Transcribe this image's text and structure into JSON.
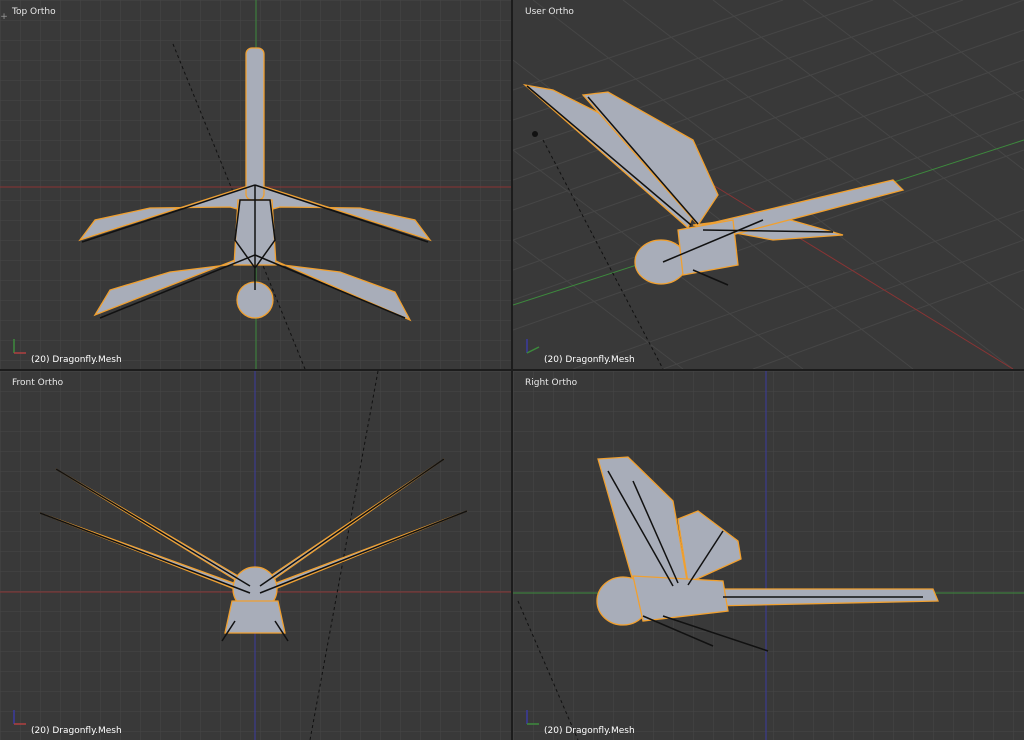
{
  "colors": {
    "viewport_bg": "#393939",
    "grid": "#464646",
    "x_axis": "#8a3434",
    "y_axis": "#3d8a3d",
    "z_axis": "#3a3aa0",
    "mesh_fill": "#a8adb9",
    "mesh_edge": "#f0a030",
    "bone": "#111111"
  },
  "viewports": [
    {
      "title": "Top Ortho",
      "status": "(20) Dragonfly.Mesh",
      "axes_labels": [
        "y",
        "x"
      ]
    },
    {
      "title": "User Ortho",
      "status": "(20) Dragonfly.Mesh",
      "axes_labels": [
        "z",
        "y"
      ]
    },
    {
      "title": "Front Ortho",
      "status": "(20) Dragonfly.Mesh",
      "axes_labels": [
        "z",
        "x"
      ]
    },
    {
      "title": "Right Ortho",
      "status": "(20) Dragonfly.Mesh",
      "axes_labels": [
        "z",
        "y"
      ]
    }
  ],
  "corner_widget": "+"
}
